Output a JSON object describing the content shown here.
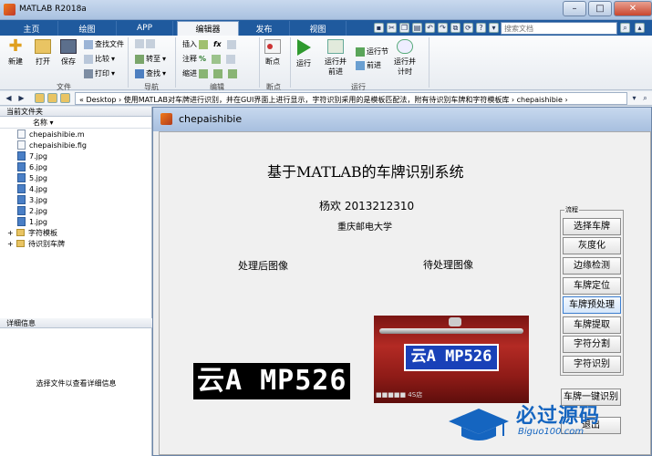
{
  "window": {
    "title": "MATLAB R2018a"
  },
  "tabs": [
    "主页",
    "绘图",
    "APP",
    "编辑器",
    "发布",
    "视图"
  ],
  "search": {
    "placeholder": "搜索文档"
  },
  "ribbon": {
    "file_group": {
      "label": "文件",
      "new": "新建",
      "open": "打开",
      "save": "保存",
      "find_files": "查找文件",
      "compare": "比较",
      "print": "打印"
    },
    "nav_group": {
      "label": "导航",
      "goto": "转至",
      "find": "查找"
    },
    "edit_group": {
      "label": "编辑",
      "insert": "插入",
      "comment": "注释",
      "indent": "缩进",
      "fx": "fx"
    },
    "breakpoint_group": {
      "label": "断点",
      "breakpoints": "断点"
    },
    "run_group": {
      "label": "运行",
      "run": "运行",
      "run_advance": "运行并\n前进",
      "run_section": "运行节",
      "advance": "前进",
      "run_time": "运行并\n计时"
    }
  },
  "address": {
    "path": "« Desktop › 使用MATLAB对车牌进行识别，并在GUI界面上进行显示，字符识别采用的是模板匹配法，附有待识别车牌和字符模板库 › chepaishibie ›"
  },
  "file_panel": {
    "title": "当前文件夹",
    "name_col": "名称",
    "files": [
      "chepaishibie.m",
      "chepaishibie.fig",
      "7.jpg",
      "6.jpg",
      "5.jpg",
      "4.jpg",
      "3.jpg",
      "2.jpg",
      "1.jpg"
    ],
    "folders": [
      "字符模板",
      "待识别车牌"
    ],
    "detail_title": "详细信息",
    "detail_hint": "选择文件以查看详细信息"
  },
  "figure": {
    "title": "chepaishibie",
    "heading": "基于MATLAB的车牌识别系统",
    "author": "杨欢   2013212310",
    "school": "重庆邮电大学",
    "processed_label": "处理后图像",
    "pending_label": "待处理图像",
    "processed_plate": "云A MP526",
    "photo_plate": "云A MP526",
    "photo_dealer": "■■■■■ 4S店",
    "panel_legend": "流程",
    "buttons": [
      "选择车牌",
      "灰度化",
      "边缘检测",
      "车牌定位",
      "车牌预处理",
      "车牌提取",
      "字符分割",
      "字符识别"
    ],
    "one_click": "车牌一键识别",
    "exit": "退出"
  },
  "watermark": {
    "cn": "必过源码",
    "en": "Biguo100.com"
  },
  "colors": {
    "accent": "#1f5a9e",
    "watermark": "#1565c0",
    "plate_blue": "#1941b8"
  }
}
